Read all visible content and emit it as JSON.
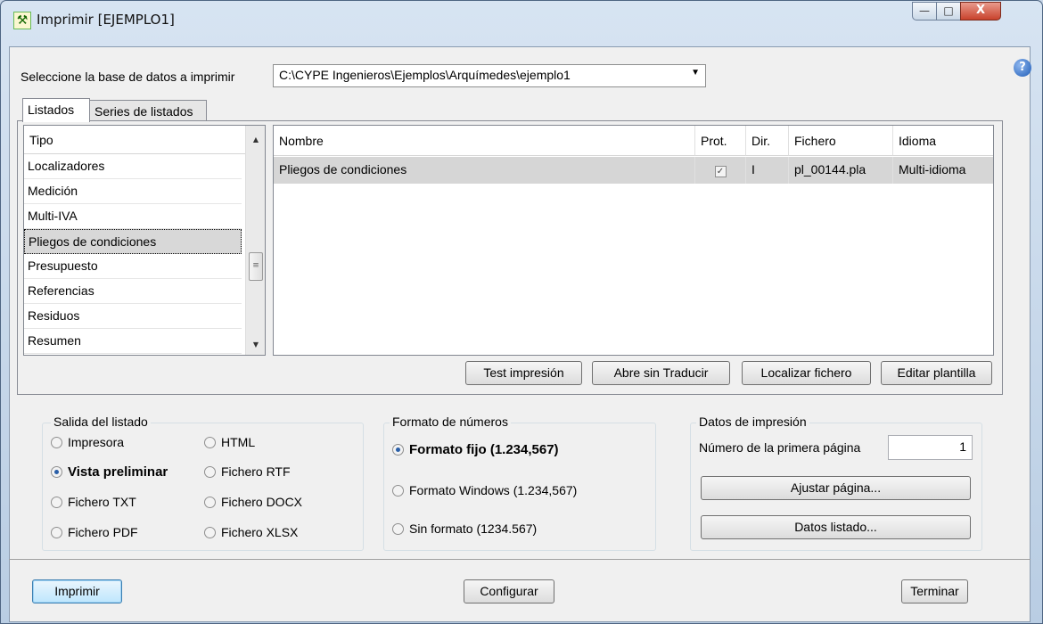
{
  "window": {
    "title": "Imprimir [EJEMPLO1]",
    "min_glyph": "—",
    "max_glyph": "□",
    "close_glyph": "X",
    "help_glyph": "?"
  },
  "db": {
    "label": "Seleccione la base de datos a imprimir",
    "value": "C:\\CYPE Ingenieros\\Ejemplos\\Arquímedes\\ejemplo1"
  },
  "tabs": [
    "Listados",
    "Series de listados"
  ],
  "tipo": {
    "header": "Tipo",
    "items": [
      "Localizadores",
      "Medición",
      "Multi-IVA",
      "Pliegos de condiciones",
      "Presupuesto",
      "Referencias",
      "Residuos",
      "Resumen"
    ],
    "selected": "Pliegos de condiciones"
  },
  "grid": {
    "columns": [
      "Nombre",
      "Prot.",
      "Dir.",
      "Fichero",
      "Idioma"
    ],
    "rows": [
      {
        "nombre": "Pliegos de condiciones",
        "prot": true,
        "dir": "I",
        "fichero": "pl_00144.pla",
        "idioma": "Multi-idioma"
      }
    ]
  },
  "buttons": {
    "test": "Test impresión",
    "abre": "Abre sin Traducir",
    "localizar": "Localizar fichero",
    "editar": "Editar plantilla",
    "ajustar": "Ajustar página...",
    "datos": "Datos listado...",
    "imprimir": "Imprimir",
    "configurar": "Configurar",
    "terminar": "Terminar"
  },
  "salida": {
    "legend": "Salida del listado",
    "options": [
      "Impresora",
      "HTML",
      "Vista preliminar",
      "Fichero RTF",
      "Fichero TXT",
      "Fichero DOCX",
      "Fichero PDF",
      "Fichero XLSX"
    ],
    "selected": "Vista preliminar"
  },
  "formato": {
    "legend": "Formato de números",
    "options": [
      "Formato fijo (1.234,567)",
      "Formato Windows (1.234,567)",
      "Sin formato (1234.567)"
    ],
    "selected": "Formato fijo (1.234,567)"
  },
  "datos_impresion": {
    "legend": "Datos de impresión",
    "primera_pagina_label": "Número de la primera página",
    "primera_pagina_value": "1"
  },
  "colors": {
    "accent": "#2a5fa8",
    "close": "#c8422c"
  }
}
